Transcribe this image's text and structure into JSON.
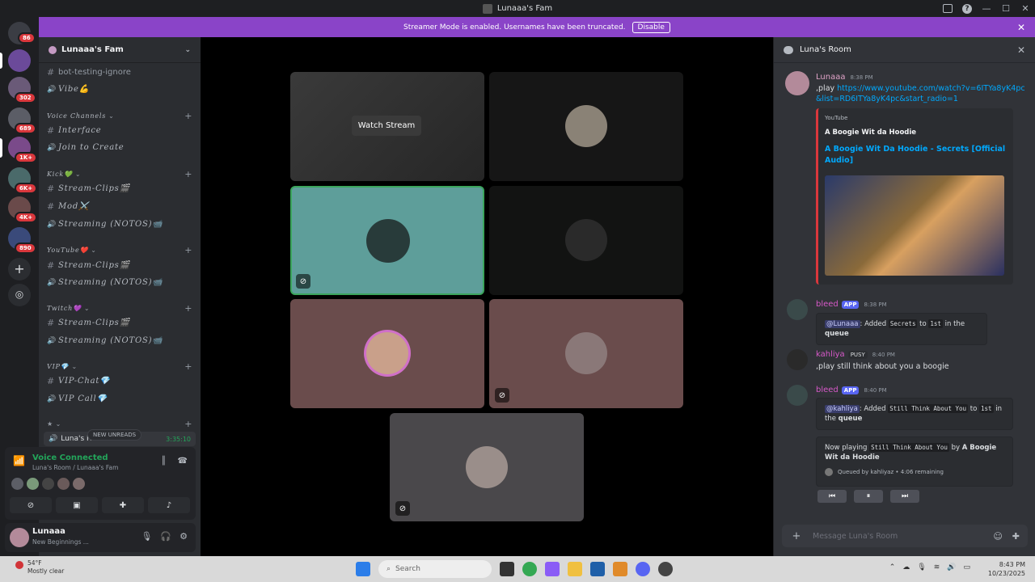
{
  "window": {
    "title": "Lunaaa's Fam"
  },
  "banner": {
    "text": "Streamer Mode is enabled. Usernames have been truncated.",
    "button": "Disable"
  },
  "rail": {
    "badges": [
      "86",
      "302",
      "689",
      "1K+",
      "6K+",
      "4K+",
      "890"
    ]
  },
  "guild": {
    "name": "Lunaaa's Fam"
  },
  "channels": {
    "top": [
      {
        "type": "text",
        "label": "bot-testing-ignore"
      },
      {
        "type": "voice",
        "label": "Vibe💪"
      }
    ],
    "categories": [
      {
        "name": "Voice Channels",
        "items": [
          {
            "type": "text",
            "label": "Interface"
          },
          {
            "type": "voice",
            "label": "Join to Create"
          }
        ]
      },
      {
        "name": "Kick💚",
        "items": [
          {
            "type": "text",
            "label": "Stream-Clips🎬"
          },
          {
            "type": "text",
            "label": "Mod⚔️"
          },
          {
            "type": "voice",
            "label": "Streaming (NOTOS)📹"
          }
        ]
      },
      {
        "name": "YouTube❤️",
        "items": [
          {
            "type": "text",
            "label": "Stream-Clips🎬"
          },
          {
            "type": "voice",
            "label": "Streaming (NOTOS)📹"
          }
        ]
      },
      {
        "name": "Twitch💜",
        "items": [
          {
            "type": "text",
            "label": "Stream-Clips🎬"
          },
          {
            "type": "voice",
            "label": "Streaming (NOTOS)📹"
          }
        ]
      },
      {
        "name": "VIP💎",
        "items": [
          {
            "type": "text",
            "label": "VIP-Chat💎"
          },
          {
            "type": "voice",
            "label": "VIP Call💎"
          }
        ]
      }
    ],
    "last_category": "★",
    "new_unreads": "NEW UNREADS",
    "current_channel": "Luna's R",
    "current_timer": "3:35:10"
  },
  "voice": {
    "title": "Voice Connected",
    "subtitle": "Luna's Room / Lunaaa's Fam"
  },
  "user": {
    "name": "Lunaaa",
    "status": "New Beginnings ..."
  },
  "stage": {
    "watch_stream": "Watch Stream"
  },
  "chat": {
    "title": "Luna's Room",
    "messages": [
      {
        "author": "Lunaaa",
        "time": "8:38 PM",
        "prefix": ",play ",
        "link": "https://www.youtube.com/watch?v=6ITYa8yK4pc&list=RD6ITYa8yK4pc&start_radio=1",
        "embed": {
          "provider": "YouTube",
          "author": "A Boogie Wit da Hoodie",
          "title": "A Boogie Wit Da Hoodie - Secrets [Official Audio]"
        }
      },
      {
        "author": "bleed",
        "tag": "APP",
        "time": "8:38 PM",
        "mention": "@Lunaaa",
        "pre": ": Added ",
        "code1": "Secrets",
        "mid": " to ",
        "code2": "1st",
        "post1": " in the ",
        "post2": "queue"
      },
      {
        "author": "kahliya",
        "role": "PUSY",
        "time": "8:40 PM",
        "text": ",play still think about you a boogie"
      },
      {
        "author": "bleed",
        "tag": "APP",
        "time": "8:40 PM",
        "mention": "@kahliya",
        "pre": ": Added ",
        "code1": "Still Think About You",
        "mid": " to ",
        "code2": "1st",
        "post1": " in the ",
        "post2": "queue",
        "now_playing": {
          "label": "Now playing ",
          "track": "Still Think About You",
          "by": " by ",
          "artist": "A Boogie Wit da Hoodie",
          "queued": "Queued by kahliyaz • 4:06 remaining"
        }
      }
    ],
    "composer_placeholder": "Message Luna's Room"
  },
  "taskbar": {
    "weather_temp": "54°F",
    "weather_desc": "Mostly clear",
    "search": "Search",
    "time": "8:43 PM",
    "date": "10/23/2025"
  }
}
